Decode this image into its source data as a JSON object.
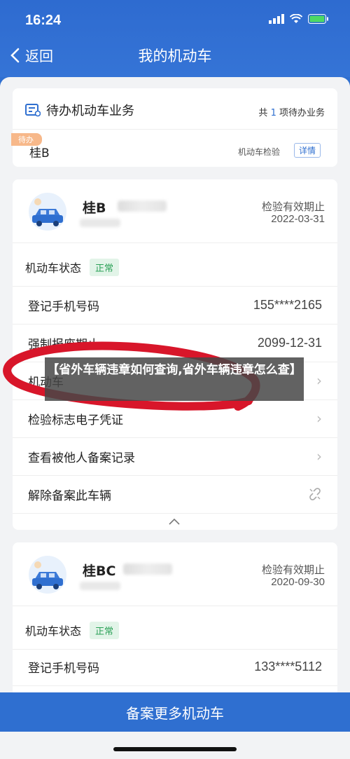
{
  "status_bar": {
    "time": "16:24"
  },
  "nav": {
    "back_label": "返回",
    "title": "我的机动车"
  },
  "todo": {
    "title": "待办机动车业务",
    "count_prefix": "共",
    "count": "1",
    "count_suffix": "项待办业务",
    "badge": "待办",
    "plate": "桂B",
    "type": "机动车检验",
    "detail_label": "详情"
  },
  "vehicles": [
    {
      "plate": "桂B",
      "expiry_label": "检验有效期止",
      "expiry_date": "2022-03-31",
      "status_label": "机动车状态",
      "status_value": "正常",
      "rows": [
        {
          "label": "登记手机号码",
          "value": "155****2165"
        },
        {
          "label": "强制报废期止",
          "value": "2099-12-31"
        },
        {
          "label": "机动车"
        },
        {
          "label": "检验标志电子凭证"
        },
        {
          "label": "查看被他人备案记录"
        },
        {
          "label": "解除备案此车辆"
        }
      ]
    },
    {
      "plate": "桂BC",
      "expiry_label": "检验有效期止",
      "expiry_date": "2020-09-30",
      "status_label": "机动车状态",
      "status_value": "正常",
      "rows": [
        {
          "label": "登记手机号码",
          "value": "133****5112"
        }
      ]
    }
  ],
  "bottom_button": "备案更多机动车",
  "overlay_text": "【省外车辆违章如何查询,省外车辆违章怎么查】",
  "colors": {
    "primary": "#2f6fd0",
    "status_green": "#2aa056",
    "badge_orange": "#f7b88a",
    "annotation_red": "#d8162a"
  },
  "icons": [
    "chevron-left-icon",
    "todo-list-icon",
    "car-icon",
    "chevron-right-icon",
    "unlink-icon",
    "chevron-up-icon",
    "signal-icon",
    "wifi-icon",
    "battery-icon"
  ]
}
